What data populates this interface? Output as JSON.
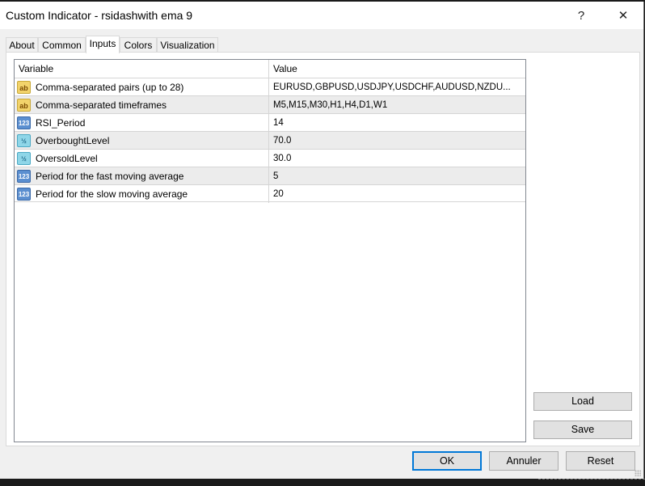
{
  "window": {
    "title": "Custom Indicator - rsidashwith ema 9",
    "help_icon": "?",
    "close_icon": "✕"
  },
  "tabs": [
    {
      "label": "About",
      "active": false
    },
    {
      "label": "Common",
      "active": false
    },
    {
      "label": "Inputs",
      "active": true
    },
    {
      "label": "Colors",
      "active": false
    },
    {
      "label": "Visualization",
      "active": false
    }
  ],
  "grid": {
    "columns": [
      "Variable",
      "Value"
    ],
    "rows": [
      {
        "icon": "string-type-icon",
        "icon_glyph": "ab",
        "variable": "Comma-separated pairs (up to 28)",
        "value": "EURUSD,GBPUSD,USDJPY,USDCHF,AUDUSD,NZDU..."
      },
      {
        "icon": "string-type-icon",
        "icon_glyph": "ab",
        "variable": "Comma-separated timeframes",
        "value": "M5,M15,M30,H1,H4,D1,W1"
      },
      {
        "icon": "integer-type-icon",
        "icon_glyph": "123",
        "variable": "RSI_Period",
        "value": "14"
      },
      {
        "icon": "double-type-icon",
        "icon_glyph": "½",
        "variable": "OverboughtLevel",
        "value": "70.0"
      },
      {
        "icon": "double-type-icon",
        "icon_glyph": "½",
        "variable": "OversoldLevel",
        "value": "30.0"
      },
      {
        "icon": "integer-type-icon",
        "icon_glyph": "123",
        "variable": "Period for the fast moving average",
        "value": "5"
      },
      {
        "icon": "integer-type-icon",
        "icon_glyph": "123",
        "variable": "Period for the slow moving average",
        "value": "20"
      }
    ]
  },
  "side_buttons": {
    "load": "Load",
    "save": "Save"
  },
  "footer_buttons": {
    "ok": "OK",
    "cancel": "Annuler",
    "reset": "Reset"
  },
  "colors": {
    "accent": "#0078d7",
    "row_alt": "#ececec"
  }
}
